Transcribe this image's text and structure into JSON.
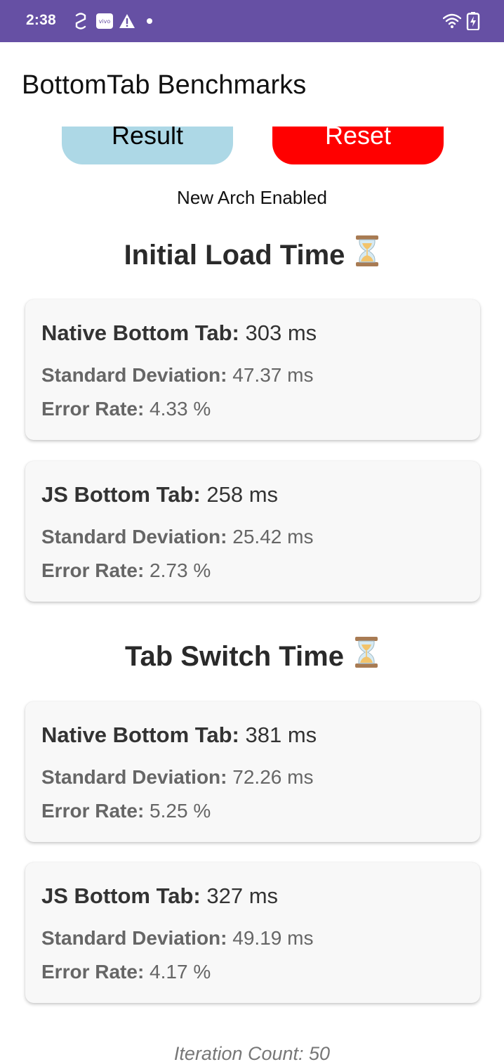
{
  "status_bar": {
    "time": "2:38",
    "icons_left": [
      "sync-icon",
      "vivo-badge-icon",
      "warning-icon",
      "dot-icon"
    ],
    "icons_right": [
      "wifi-icon",
      "battery-charging-icon"
    ],
    "background_color": "#6650a4"
  },
  "app_bar": {
    "title": "BottomTab Benchmarks"
  },
  "buttons": {
    "result_label": "Result",
    "reset_label": "Reset",
    "result_color": "#add8e6",
    "reset_color": "#ff0000"
  },
  "arch_status": "New Arch Enabled",
  "sections": [
    {
      "heading": "Initial Load Time",
      "icon": "hourglass-icon",
      "cards": [
        {
          "title_label": "Native Bottom Tab:",
          "title_value": "303 ms",
          "sd_label": "Standard Deviation:",
          "sd_value": "47.37 ms",
          "er_label": "Error Rate:",
          "er_value": "4.33 %"
        },
        {
          "title_label": "JS Bottom Tab:",
          "title_value": "258 ms",
          "sd_label": "Standard Deviation:",
          "sd_value": "25.42 ms",
          "er_label": "Error Rate:",
          "er_value": "2.73 %"
        }
      ]
    },
    {
      "heading": "Tab Switch Time",
      "icon": "hourglass-icon",
      "cards": [
        {
          "title_label": "Native Bottom Tab:",
          "title_value": "381 ms",
          "sd_label": "Standard Deviation:",
          "sd_value": "72.26 ms",
          "er_label": "Error Rate:",
          "er_value": "5.25 %"
        },
        {
          "title_label": "JS Bottom Tab:",
          "title_value": "327 ms",
          "sd_label": "Standard Deviation:",
          "sd_value": "49.19 ms",
          "er_label": "Error Rate:",
          "er_value": "4.17 %"
        }
      ]
    }
  ],
  "iteration_count": "Iteration Count: 50"
}
